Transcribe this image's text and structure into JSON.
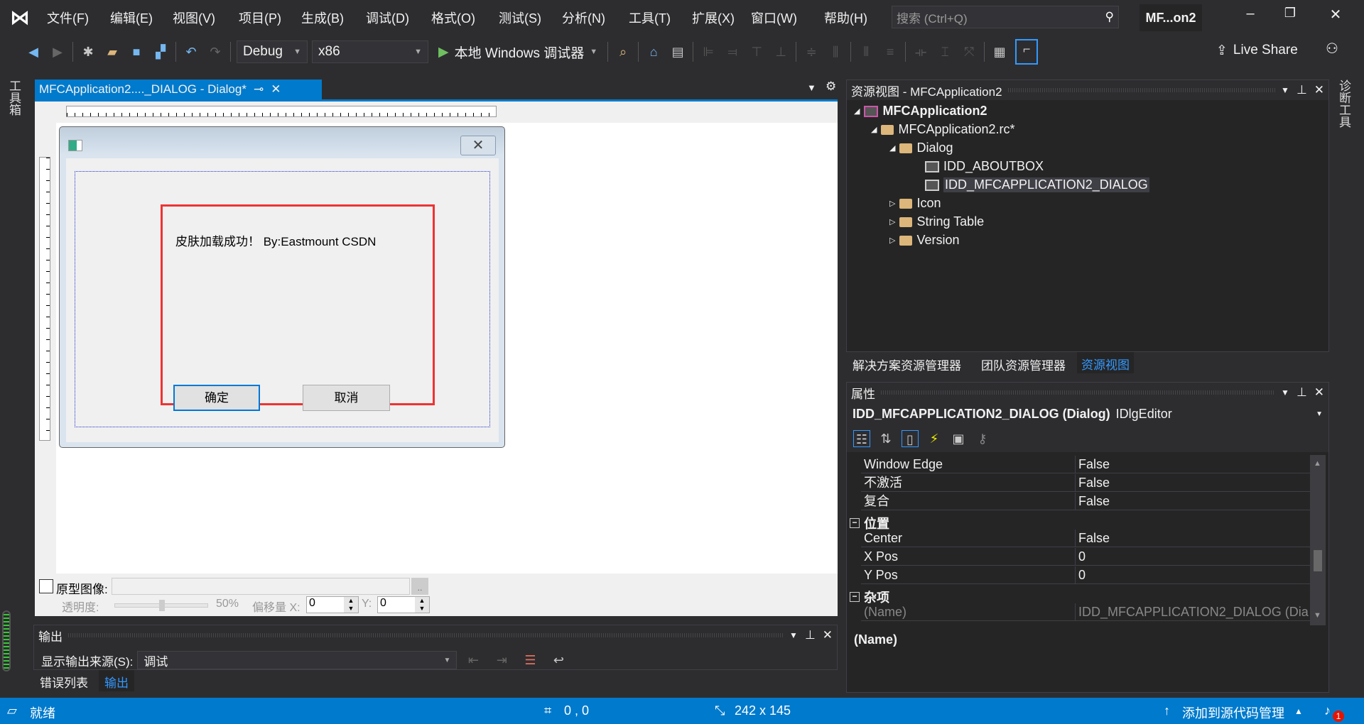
{
  "menu": {
    "items": [
      "文件(F)",
      "编辑(E)",
      "视图(V)",
      "项目(P)",
      "生成(B)",
      "调试(D)",
      "格式(O)",
      "测试(S)",
      "分析(N)",
      "工具(T)",
      "扩展(X)",
      "窗口(W)",
      "帮助(H)"
    ],
    "search_placeholder": "搜索 (Ctrl+Q)",
    "window_title": "MF...on2"
  },
  "toolbar": {
    "config": "Debug",
    "platform": "x86",
    "run_label": "本地 Windows 调试器",
    "live_share": "Live Share"
  },
  "left_strip": {
    "toolbox": "工具箱"
  },
  "right_strip": {
    "diagnostics": "诊断工具"
  },
  "editor": {
    "tab_label": "MFCApplication2...._DIALOG - Dialog*",
    "dialog": {
      "static_text": "皮肤加载成功！ By:Eastmount CSDN",
      "ok": "确定",
      "cancel": "取消"
    },
    "prototype": {
      "checkbox_label": "原型图像:",
      "browse": "..",
      "opacity_label": "透明度:",
      "opacity_value": "50%",
      "opacity_fraction": 0.5,
      "offset_label": "偏移量 X:",
      "x_value": "0",
      "y_label": "Y:",
      "y_value": "0"
    }
  },
  "output": {
    "title": "输出",
    "source_label": "显示输出来源(S):",
    "source_value": "调试",
    "tabs": [
      "错误列表",
      "输出"
    ],
    "active_tab": "输出"
  },
  "resource_view": {
    "title": "资源视图 - MFCApplication2",
    "tree": [
      "MFCApplication2",
      "MFCApplication2.rc*",
      "Dialog",
      "IDD_ABOUTBOX",
      "IDD_MFCAPPLICATION2_DIALOG",
      "Icon",
      "String Table",
      "Version"
    ],
    "tabs": [
      "解决方案资源管理器",
      "团队资源管理器",
      "资源视图"
    ],
    "active_tab": "资源视图"
  },
  "properties": {
    "title": "属性",
    "object": "IDD_MFCAPPLICATION2_DIALOG (Dialog)",
    "object_type": "IDlgEditor",
    "rows": [
      {
        "k": "Window Edge",
        "v": "False"
      },
      {
        "k": "不激活",
        "v": "False"
      },
      {
        "k": "复合",
        "v": "False"
      }
    ],
    "cat_pos": "位置",
    "pos_rows": [
      {
        "k": "Center",
        "v": "False"
      },
      {
        "k": "X Pos",
        "v": "0"
      },
      {
        "k": "Y Pos",
        "v": "0"
      }
    ],
    "cat_misc": "杂项",
    "misc_rows": [
      {
        "k": "(Name)",
        "v": "IDD_MFCAPPLICATION2_DIALOG (Dia"
      }
    ],
    "description": "(Name)"
  },
  "status": {
    "ready": "就绪",
    "position": "0 , 0",
    "size": "242 x 145",
    "source_control": "添加到源代码管理",
    "notifications": "1"
  },
  "colors": {
    "accent": "#007acc",
    "red_box": "#ee3333",
    "background": "#2d2d30"
  }
}
